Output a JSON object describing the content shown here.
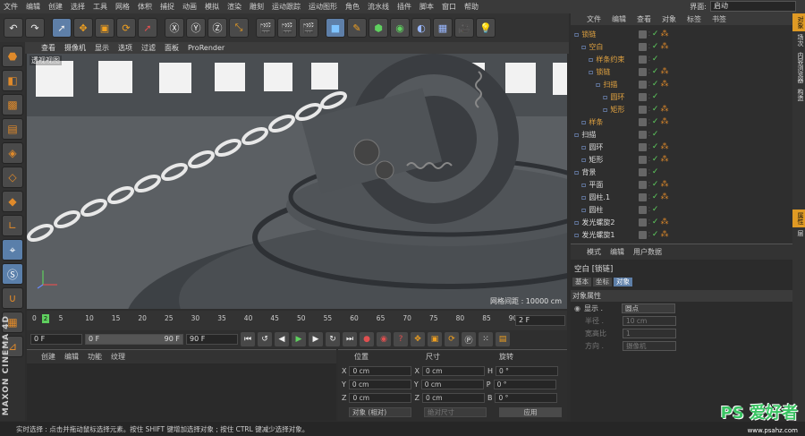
{
  "menubar": {
    "items": [
      "文件",
      "编辑",
      "创建",
      "选择",
      "工具",
      "网格",
      "体积",
      "捕捉",
      "动画",
      "模拟",
      "渲染",
      "雕刻",
      "运动跟踪",
      "运动图形",
      "角色",
      "流水线",
      "插件",
      "脚本",
      "窗口",
      "帮助"
    ],
    "interface_label": "界面:",
    "interface_value": "启动"
  },
  "viewport": {
    "menu": [
      "查看",
      "摄像机",
      "显示",
      "选项",
      "过滤",
      "面板",
      "ProRender"
    ],
    "label": "透视视图",
    "grid_spacing": "网格间距 : 10000 cm"
  },
  "timeline": {
    "ticks": [
      "0",
      "5",
      "10",
      "15",
      "20",
      "25",
      "30",
      "35",
      "40",
      "45",
      "50",
      "55",
      "60",
      "65",
      "70",
      "75",
      "80",
      "85",
      "90"
    ],
    "current_frame": "2",
    "frame_field": "2 F"
  },
  "transport": {
    "start": "0 F",
    "range_start": "0 F",
    "range_end": "90 F",
    "end": "90 F"
  },
  "material_panel": {
    "menu": [
      "创建",
      "编辑",
      "功能",
      "纹理"
    ]
  },
  "coord_panel": {
    "headers": [
      "位置",
      "尺寸",
      "旋转"
    ],
    "rows": [
      {
        "axis": "X",
        "pos": "0 cm",
        "size_axis": "X",
        "size": "0 cm",
        "rot_axis": "H",
        "rot": "0 °"
      },
      {
        "axis": "Y",
        "pos": "0 cm",
        "size_axis": "Y",
        "size": "0 cm",
        "rot_axis": "P",
        "rot": "0 °"
      },
      {
        "axis": "Z",
        "pos": "0 cm",
        "size_axis": "Z",
        "size": "0 cm",
        "rot_axis": "B",
        "rot": "0 °"
      }
    ],
    "mode": "对象 (相对)",
    "size_mode": "绝对尺寸",
    "apply": "应用"
  },
  "object_panel": {
    "tabs": [
      "文件",
      "编辑",
      "查看",
      "对象",
      "标签",
      "书签"
    ],
    "objects": [
      {
        "name": "锁链",
        "color": "orange",
        "indent": 0
      },
      {
        "name": "空白",
        "color": "orange",
        "indent": 1
      },
      {
        "name": "样条约束",
        "color": "orange",
        "indent": 2
      },
      {
        "name": "锁链",
        "color": "orange",
        "indent": 2
      },
      {
        "name": "扫描",
        "color": "orange",
        "indent": 3
      },
      {
        "name": "圆环",
        "color": "orange",
        "indent": 4
      },
      {
        "name": "矩形",
        "color": "orange",
        "indent": 4
      },
      {
        "name": "样条",
        "color": "orange",
        "indent": 1
      },
      {
        "name": "扫描",
        "color": "white",
        "indent": 0
      },
      {
        "name": "圆环",
        "color": "white",
        "indent": 1
      },
      {
        "name": "矩形",
        "color": "white",
        "indent": 1
      },
      {
        "name": "背景",
        "color": "white",
        "indent": 0
      },
      {
        "name": "平面",
        "color": "white",
        "indent": 1
      },
      {
        "name": "圆柱.1",
        "color": "white",
        "indent": 1
      },
      {
        "name": "圆柱",
        "color": "white",
        "indent": 1
      },
      {
        "name": "发光螺旋2",
        "color": "white",
        "indent": 0
      },
      {
        "name": "发光螺旋1",
        "color": "white",
        "indent": 0
      }
    ]
  },
  "attr_panel": {
    "menu": [
      "模式",
      "编辑",
      "用户数据"
    ],
    "title": "空白 [锁链]",
    "subtabs": [
      "基本",
      "坐标",
      "对象"
    ],
    "section": "对象属性",
    "props": [
      {
        "label": "显示 .",
        "value": "圆点",
        "dim": false
      },
      {
        "label": "半径 .",
        "value": "10 cm",
        "dim": true
      },
      {
        "label": "宽高比",
        "value": "1",
        "dim": true
      },
      {
        "label": "方向 .",
        "value": "摄像机",
        "dim": true
      }
    ]
  },
  "side_tabs_top": [
    "对象",
    "场次",
    "内容浏览器",
    "构造"
  ],
  "side_tabs_bottom": [
    "属性",
    "层"
  ],
  "status": "实时选择 : 点击并拖动鼠标选择元素。按住 SHIFT 键增加选择对象 ; 按住 CTRL 键减少选择对象。",
  "watermark": {
    "main": "PS 爱好者",
    "sub": "www.psahz.com"
  },
  "colors": {
    "accent": "#e09a24",
    "selection": "#5e7fa8",
    "green": "#5fd05f"
  }
}
